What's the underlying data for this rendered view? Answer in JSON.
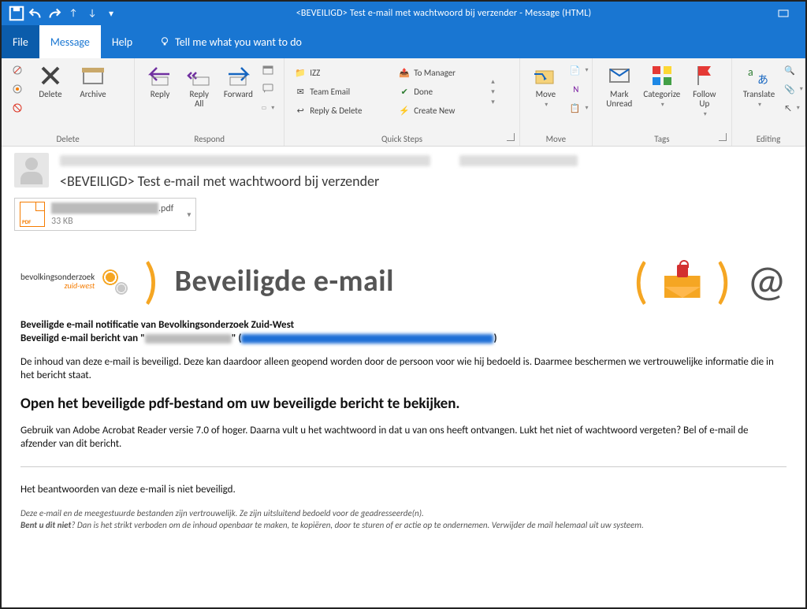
{
  "title": "<BEVEILIGD> Test e-mail met wachtwoord bij verzender  -  Message (HTML)",
  "menu": {
    "file": "File",
    "message": "Message",
    "help": "Help",
    "tell_me": "Tell me what you want to do"
  },
  "ribbon": {
    "delete_group": "Delete",
    "delete": "Delete",
    "archive": "Archive",
    "respond_group": "Respond",
    "reply": "Reply",
    "reply_all": "Reply\nAll",
    "forward": "Forward",
    "quick_steps_group": "Quick Steps",
    "qs_izz": "IZZ",
    "qs_team": "Team Email",
    "qs_replydel": "Reply & Delete",
    "qs_mgr": "To Manager",
    "qs_done": "Done",
    "qs_new": "Create New",
    "move_group": "Move",
    "move": "Move",
    "tags_group": "Tags",
    "mark_unread": "Mark\nUnread",
    "categorize": "Categorize",
    "follow_up": "Follow\nUp",
    "editing_group": "Editing",
    "translate": "Translate"
  },
  "header": {
    "subject": "<BEVEILIGD> Test e-mail met wachtwoord bij verzender"
  },
  "attachment": {
    "ext": ".pdf",
    "size": "33 KB"
  },
  "body": {
    "org_top": "bevolkingsonderzoek",
    "org_sub": "zuid-west",
    "banner": "Beveiligde e-mail",
    "at": "@",
    "line1": "Beveiligde e-mail notificatie van Bevolkingsonderzoek Zuid-West",
    "line2_a": "Beveiligd e-mail bericht van \"",
    "line2_b": "\" (",
    "line2_c": ")",
    "p1": "De inhoud van deze e-mail is beveiligd. Deze kan daardoor alleen geopend worden door de persoon voor wie hij bedoeld is. Daarmee beschermen we vertrouwelijke informatie die in het bericht staat.",
    "h2": "Open het beveiligde pdf-bestand om uw beveiligde bericht te bekijken.",
    "p2": "Gebruik van Adobe Acrobat Reader versie 7.0 of hoger. Daarna vult u het wachtwoord in dat u van ons heeft ontvangen. Lukt het niet of wachtwoord vergeten? Bel of e-mail de afzender van dit bericht.",
    "p3": "Het beantwoorden van deze e-mail is niet beveiligd.",
    "d1": "Deze e-mail en de meegestuurde bestanden zijn vertrouwelijk. Ze zijn uitsluitend bedoeld voor de geadresseerde(n).",
    "d2a": "Bent u dit niet",
    "d2b": "? Dan is het strikt verboden om de inhoud openbaar te maken, te kopiëren, door te sturen of er actie op te ondernemen. Verwijder de mail helemaal uit uw systeem."
  }
}
